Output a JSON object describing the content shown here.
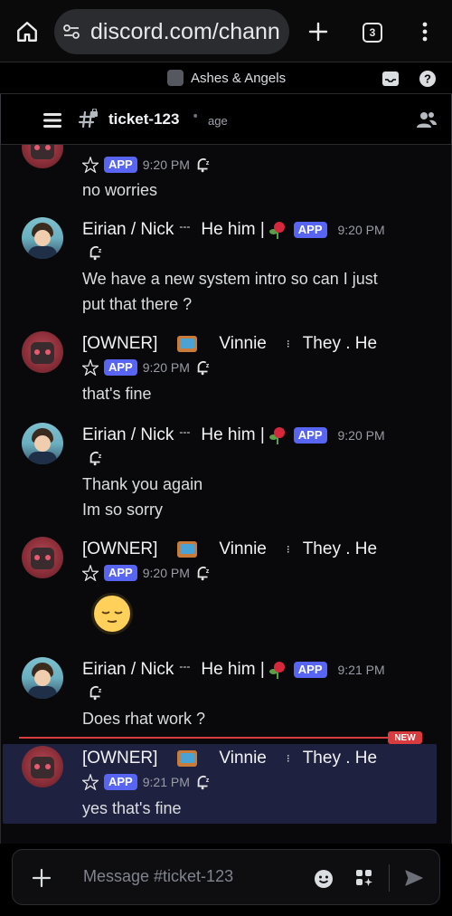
{
  "browser": {
    "url": "discord.com/chann",
    "tab_count": "3"
  },
  "server": {
    "name": "Ashes & Angels"
  },
  "channel": {
    "name": "ticket-123",
    "topic": "age"
  },
  "messages": [
    {
      "author": "",
      "time": "9:20 PM",
      "badge": "APP",
      "lines": [
        "no worries"
      ]
    },
    {
      "author_prefix": "Eirian / Nick",
      "author_sep": "---",
      "author_suffix": "He him |",
      "time": "9:20 PM",
      "badge": "APP",
      "lines": [
        "We have a new system intro so can I just",
        "put that there ?"
      ]
    },
    {
      "author_prefix": "[OWNER]",
      "author_mid": "Vinnie",
      "author_suffix": "They . He",
      "time": "9:20 PM",
      "badge": "APP",
      "lines": [
        "that's fine"
      ]
    },
    {
      "author_prefix": "Eirian / Nick",
      "author_sep": "---",
      "author_suffix": "He him |",
      "time": "9:20 PM",
      "badge": "APP",
      "lines": [
        "Thank you again",
        "Im so sorry"
      ]
    },
    {
      "author_prefix": "[OWNER]",
      "author_mid": "Vinnie",
      "author_suffix": "They . He",
      "time": "9:20 PM",
      "badge": "APP",
      "lines": []
    },
    {
      "author_prefix": "Eirian / Nick",
      "author_sep": "---",
      "author_suffix": "He him |",
      "time": "9:21 PM",
      "badge": "APP",
      "lines": [
        "Does rhat work ?"
      ]
    },
    {
      "author_prefix": "[OWNER]",
      "author_mid": "Vinnie",
      "author_suffix": "They . He",
      "time": "9:21 PM",
      "badge": "APP",
      "lines": [
        "yes that's fine"
      ]
    }
  ],
  "new_divider_label": "NEW",
  "composer": {
    "placeholder": "Message #ticket-123"
  },
  "icons": {
    "home": "home-icon",
    "site_settings": "site-settings-icon",
    "new_tab": "plus-icon",
    "more": "kebab-icon",
    "inbox": "inbox-icon",
    "help": "help-icon",
    "menu": "hamburger-icon",
    "channel": "text-channel-locked-icon",
    "members": "members-icon",
    "pentagram": "pentagram-icon",
    "snooze": "bell-snooze-icon",
    "add": "plus-icon",
    "emoji": "emoji-icon",
    "apps": "apps-icon",
    "send": "send-icon"
  },
  "colors": {
    "blurple": "#5865f2",
    "new_red": "#d83c3e",
    "highlight": "#1f2140"
  }
}
